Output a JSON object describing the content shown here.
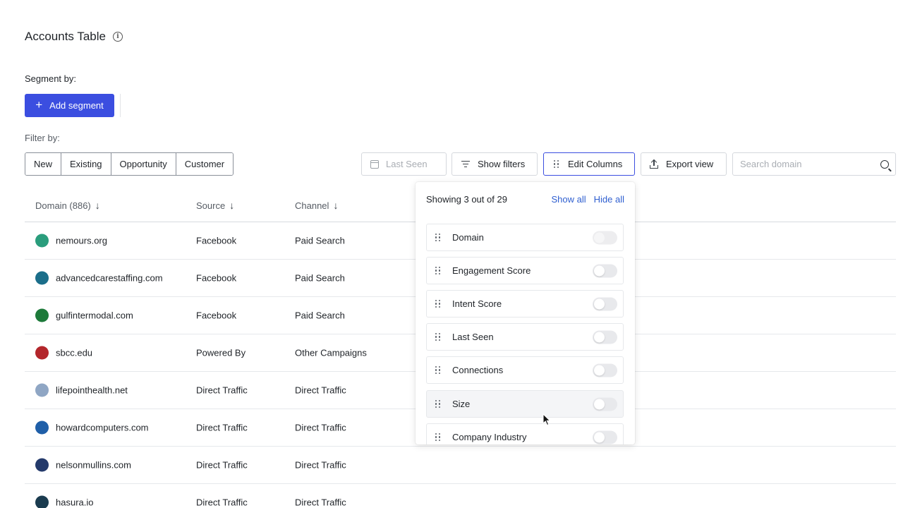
{
  "page": {
    "title": "Accounts Table"
  },
  "segment": {
    "label": "Segment by:",
    "add_button": "Add segment"
  },
  "filter": {
    "label": "Filter by:",
    "options": [
      "New",
      "Existing",
      "Opportunity",
      "Customer"
    ]
  },
  "toolbar": {
    "last_seen_placeholder": "Last Seen",
    "show_filters": "Show filters",
    "edit_columns": "Edit Columns",
    "export_view": "Export view",
    "search_placeholder": "Search domain"
  },
  "table": {
    "columns": [
      {
        "label": "Domain (886)"
      },
      {
        "label": "Source"
      },
      {
        "label": "Channel"
      }
    ],
    "rows": [
      {
        "domain": "nemours.org",
        "source": "Facebook",
        "channel": "Paid Search",
        "logo_color": "#2a9d7c"
      },
      {
        "domain": "advancedcarestaffing.com",
        "source": "Facebook",
        "channel": "Paid Search",
        "logo_color": "#1b6e8a"
      },
      {
        "domain": "gulfintermodal.com",
        "source": "Facebook",
        "channel": "Paid Search",
        "logo_color": "#1d7a3a"
      },
      {
        "domain": "sbcc.edu",
        "source": "Powered By",
        "channel": "Other Campaigns",
        "logo_color": "#b3262b"
      },
      {
        "domain": "lifepointhealth.net",
        "source": "Direct Traffic",
        "channel": "Direct Traffic",
        "logo_color": "#8fa6c4"
      },
      {
        "domain": "howardcomputers.com",
        "source": "Direct Traffic",
        "channel": "Direct Traffic",
        "logo_color": "#1f5fa8"
      },
      {
        "domain": "nelsonmullins.com",
        "source": "Direct Traffic",
        "channel": "Direct Traffic",
        "logo_color": "#243a6b"
      },
      {
        "domain": "hasura.io",
        "source": "Direct Traffic",
        "channel": "Direct Traffic",
        "logo_color": "#1a3b4f"
      }
    ]
  },
  "columns_panel": {
    "count_text": "Showing 3 out of 29",
    "show_all": "Show all",
    "hide_all": "Hide all",
    "items": [
      {
        "label": "Domain",
        "enabled": false,
        "locked": true
      },
      {
        "label": "Engagement Score",
        "enabled": false
      },
      {
        "label": "Intent Score",
        "enabled": false
      },
      {
        "label": "Last Seen",
        "enabled": false
      },
      {
        "label": "Connections",
        "enabled": false
      },
      {
        "label": "Size",
        "enabled": false
      },
      {
        "label": "Company Industry",
        "enabled": false
      }
    ]
  },
  "colors": {
    "accent": "#3b4ee0",
    "link": "#2f5fd0"
  }
}
